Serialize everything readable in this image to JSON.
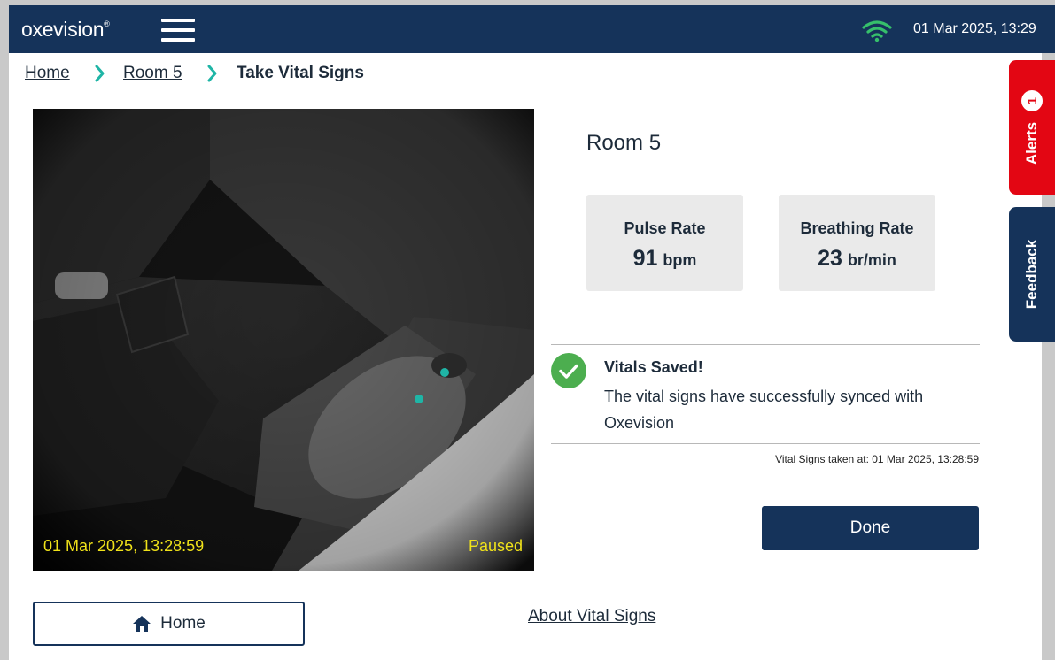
{
  "header": {
    "logo_text": "oxevision",
    "logo_mark": "®",
    "menu_icon": "hamburger-menu-icon",
    "wifi_icon": "wifi-icon",
    "datetime": "01 Mar 2025, 13:29"
  },
  "breadcrumb": {
    "home": "Home",
    "room": "Room 5",
    "current": "Take Vital Signs",
    "separator_icon": "chevron-right-icon"
  },
  "camera": {
    "timestamp": "01 Mar 2025, 13:28:59",
    "status": "Paused"
  },
  "room_title": "Room 5",
  "metrics": {
    "pulse": {
      "label": "Pulse Rate",
      "value": "91",
      "unit": "bpm"
    },
    "breathing": {
      "label": "Breathing Rate",
      "value": "23",
      "unit": "br/min"
    }
  },
  "status": {
    "icon": "check-circle-icon",
    "title": "Vitals Saved!",
    "message": "The vital signs have successfully synced with Oxevision",
    "taken_at": "Vital Signs taken at: 01 Mar 2025, 13:28:59"
  },
  "actions": {
    "done_label": "Done",
    "home_label": "Home",
    "home_icon": "home-icon",
    "about_link": "About Vital Signs"
  },
  "side_tabs": {
    "alerts_label": "Alerts",
    "alerts_count": "1",
    "feedback_label": "Feedback"
  },
  "colors": {
    "navy": "#15335a",
    "teal_accent": "#1fb5a6",
    "alert_red": "#e30613",
    "success_green": "#4cae4f",
    "camera_text": "#f0e21a"
  }
}
